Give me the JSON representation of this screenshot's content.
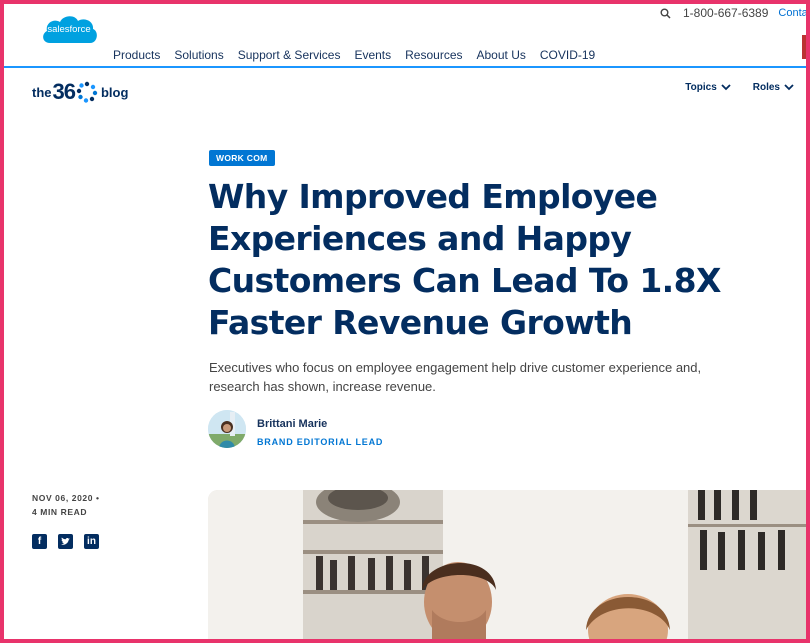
{
  "brand": {
    "logo_text": "salesforce"
  },
  "utility": {
    "phone": "1-800-667-6389",
    "contact": "Contac"
  },
  "main_nav": [
    "Products",
    "Solutions",
    "Support & Services",
    "Events",
    "Resources",
    "About Us",
    "COVID-19"
  ],
  "blog": {
    "logo_prefix": "the",
    "logo_number": "36",
    "logo_suffix": "blog",
    "menu": {
      "topics": "Topics",
      "roles": "Roles"
    }
  },
  "article": {
    "tag": "WORK COM",
    "headline": "Why Improved Employee Experiences and Happy Customers Can Lead To 1.8X Faster Revenue Growth",
    "dek": "Executives who focus on employee engagement help drive customer experience and, research has shown, increase revenue.",
    "author": {
      "name": "Brittani Marie",
      "role": "BRAND EDITORIAL LEAD"
    },
    "date": "NOV 06, 2020 •",
    "read_time": "4 MIN READ",
    "social": {
      "facebook": "f",
      "twitter": "t",
      "linkedin": "in"
    }
  },
  "colors": {
    "brand_blue": "#00a1e0",
    "navy": "#032d60",
    "accent_blue": "#0176d3",
    "frame": "#e8336b"
  }
}
